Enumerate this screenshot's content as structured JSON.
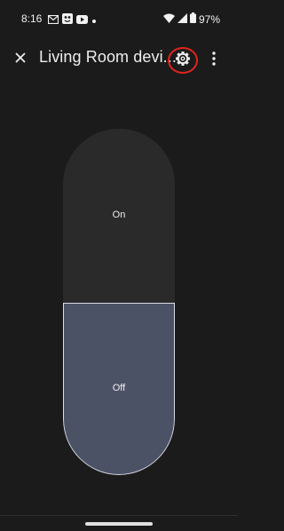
{
  "status_bar": {
    "time": "8:16",
    "left_icons": [
      "gmail-icon",
      "photos-icon",
      "youtube-icon",
      "notification-dot-icon"
    ],
    "right_icons": [
      "wifi-icon",
      "signal-icon",
      "battery-icon"
    ],
    "battery": "97%"
  },
  "app_bar": {
    "title": "Living Room devi..."
  },
  "toggle": {
    "on_label": "On",
    "off_label": "Off",
    "selected": "Off"
  },
  "colors": {
    "background": "#1b1b1b",
    "pill_unselected": "#2a2a2a",
    "pill_selected": "#4c5266",
    "highlight": "#e0241e"
  }
}
